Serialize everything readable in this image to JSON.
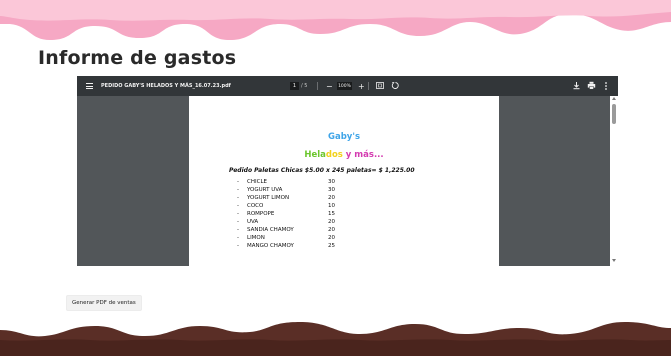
{
  "page": {
    "title": "Informe de gastos"
  },
  "colors": {
    "drip_top": "#f6a8c4",
    "drip_bottom": "#5a2e26",
    "viewer_bg": "#525659",
    "toolbar_bg": "#323639"
  },
  "viewer": {
    "toolbar": {
      "file_name": "PEDIDO GABY'S HELADOS Y MÁS_16.07.23.pdf",
      "current_page": "1",
      "page_separator": "/ 5",
      "zoom": "100%",
      "zoom_out": "−",
      "zoom_in": "+",
      "icons": [
        "menu-icon",
        "fit-page-icon",
        "rotate-icon",
        "download-icon",
        "print-icon",
        "more-icon"
      ]
    },
    "document": {
      "brand_line1": "Gaby's",
      "brand_line2_part1": "Hela",
      "brand_line2_part2": "dos",
      "brand_line2_part3": " y más...",
      "order_title": "Pedido Paletas Chicas $5.00 x 245 paletas= $ 1,225.00",
      "bullet": "-",
      "items": [
        {
          "name": "CHICLE",
          "qty": "30"
        },
        {
          "name": "YOGURT UVA",
          "qty": "30"
        },
        {
          "name": "YOGURT LIMON",
          "qty": "20"
        },
        {
          "name": "COCO",
          "qty": "10"
        },
        {
          "name": "ROMPOPE",
          "qty": "15"
        },
        {
          "name": "UVA",
          "qty": "20"
        },
        {
          "name": "SANDIA CHAMOY",
          "qty": "20"
        },
        {
          "name": "LIMON",
          "qty": "20"
        },
        {
          "name": "MANGO CHAMOY",
          "qty": "25"
        }
      ]
    }
  },
  "actions": {
    "generate_pdf_label": "Generar PDF de ventas"
  }
}
